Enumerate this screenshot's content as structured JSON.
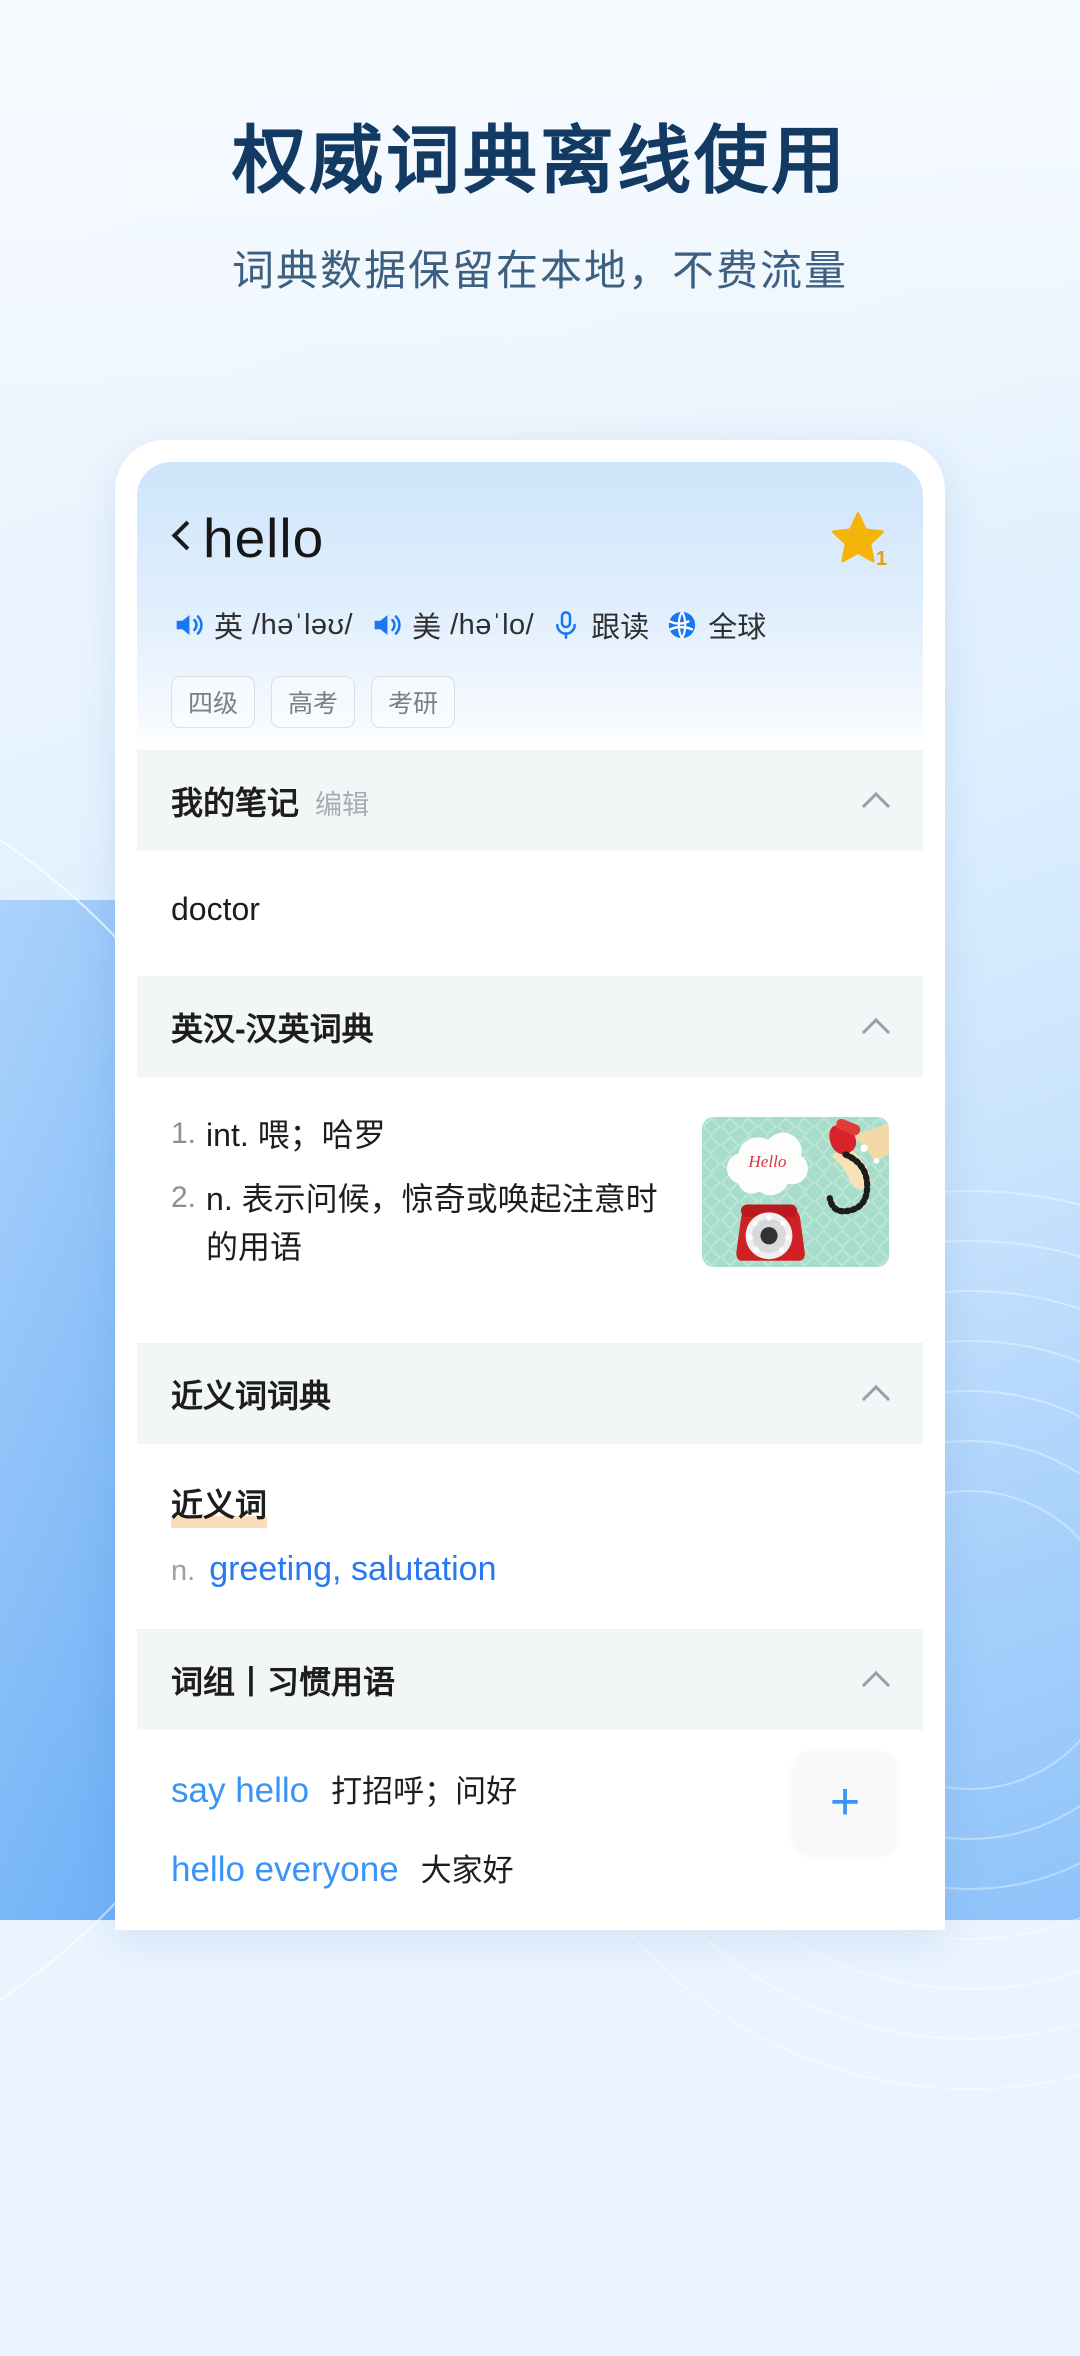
{
  "promo": {
    "title": "权威词典离线使用",
    "subtitle": "词典数据保留在本地，不费流量"
  },
  "colors": {
    "headline": "#123a63",
    "accent_blue": "#2878f0",
    "link_blue": "#3a94f5",
    "star_gold": "#f5b40a",
    "highlight_orange": "#fbddb9",
    "section_header_bg": "#f2f6f7"
  },
  "word_header": {
    "back_icon": "back-chevron-icon",
    "word": "hello",
    "favorite_icon": "star-icon",
    "favorite_count": "1",
    "phonetics": [
      {
        "speaker_icon": "speaker-icon",
        "label": "英",
        "ipa": "/həˈləʊ/"
      },
      {
        "speaker_icon": "speaker-icon",
        "label": "美",
        "ipa": "/həˈlo/"
      }
    ],
    "actions": [
      {
        "icon": "microphone-icon",
        "label": "跟读"
      },
      {
        "icon": "globe-icon",
        "label": "全球"
      }
    ],
    "tags": [
      "四级",
      "高考",
      "考研"
    ]
  },
  "sections": [
    {
      "title": "我的笔记",
      "sub": "编辑",
      "collapse_icon": "chevron-up-icon",
      "note": "doctor"
    },
    {
      "title": "英汉-汉英词典",
      "sub": "",
      "collapse_icon": "chevron-up-icon",
      "definitions": [
        {
          "num": "1.",
          "pos": "int.",
          "text": "喂；哈罗"
        },
        {
          "num": "2.",
          "pos": "n.",
          "text": "表示问候，惊奇或唤起注意时的用语"
        }
      ],
      "illustration": "hello-rotary-phone-image",
      "illustration_caption": "Hello"
    },
    {
      "title": "近义词词典",
      "sub": "",
      "collapse_icon": "chevron-up-icon",
      "syn_label": "近义词",
      "syn_pos": "n.",
      "syn_words": "greeting, salutation"
    },
    {
      "title": "词组丨习惯用语",
      "sub": "",
      "collapse_icon": "chevron-up-icon",
      "phrases": [
        {
          "en": "say hello",
          "cn": "打招呼；问好"
        },
        {
          "en": "hello everyone",
          "cn": "大家好"
        }
      ],
      "add_icon": "plus-icon",
      "add_label": "+"
    }
  ]
}
